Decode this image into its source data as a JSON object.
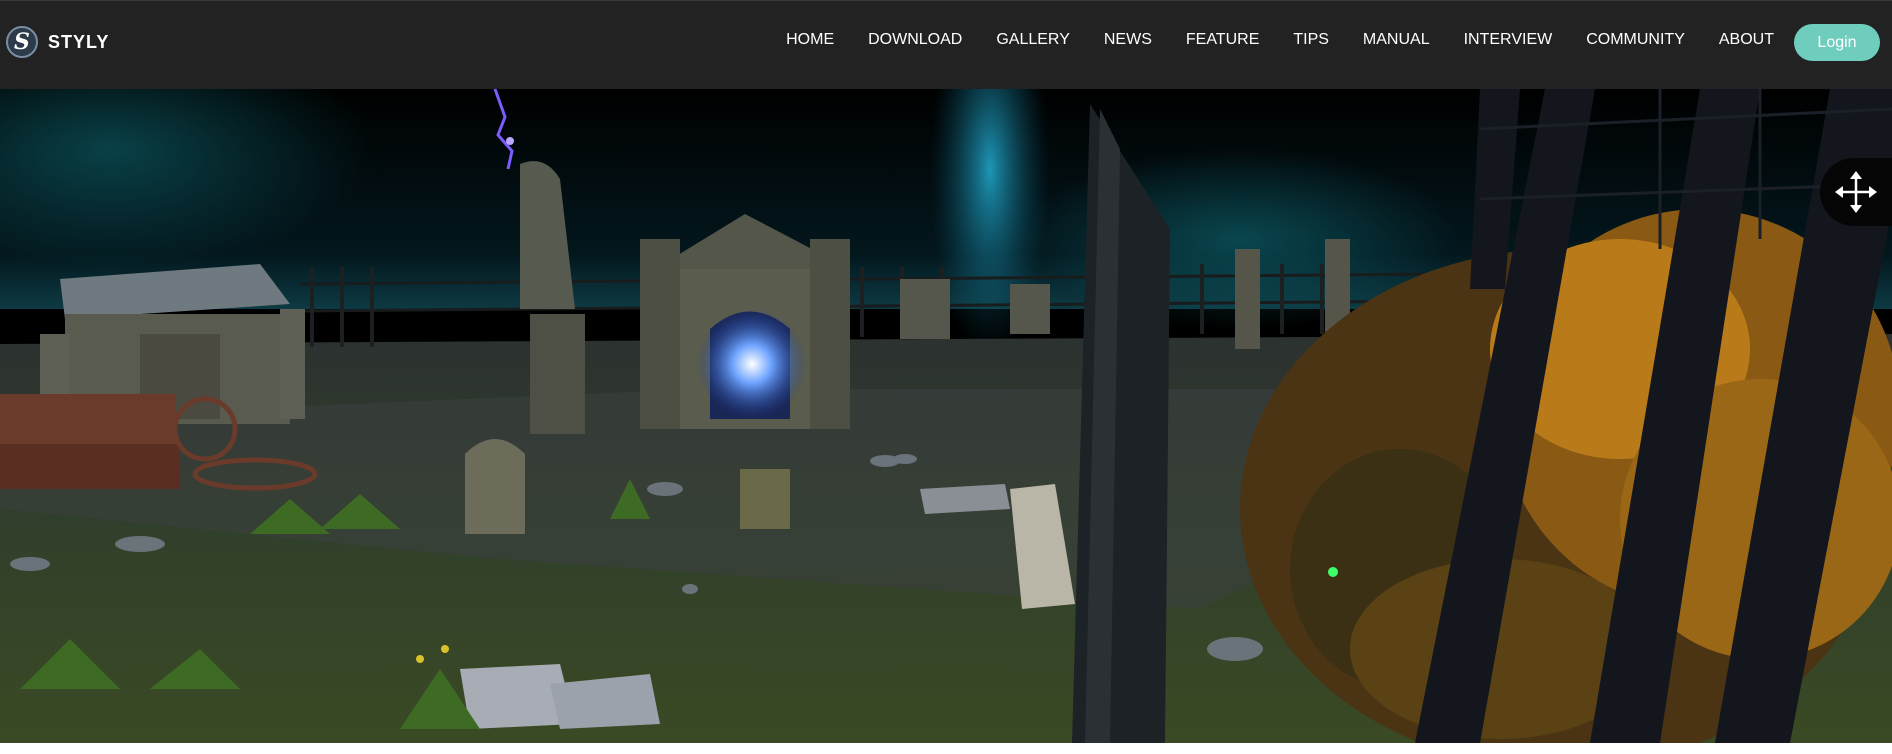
{
  "header": {
    "logo_text": "STYLY",
    "logo_glyph": "S",
    "nav": [
      {
        "label": "HOME"
      },
      {
        "label": "DOWNLOAD"
      },
      {
        "label": "GALLERY"
      },
      {
        "label": "NEWS"
      },
      {
        "label": "FEATURE"
      },
      {
        "label": "TIPS"
      },
      {
        "label": "MANUAL"
      },
      {
        "label": "INTERVIEW"
      },
      {
        "label": "COMMUNITY"
      },
      {
        "label": "ABOUT"
      }
    ],
    "login_label": "Login"
  },
  "viewer": {
    "scene": "graveyard-3d-scene",
    "move_control_icon": "move-arrows-icon"
  },
  "colors": {
    "header_bg": "#222222",
    "accent": "#6fcdbd",
    "text": "#ffffff"
  }
}
